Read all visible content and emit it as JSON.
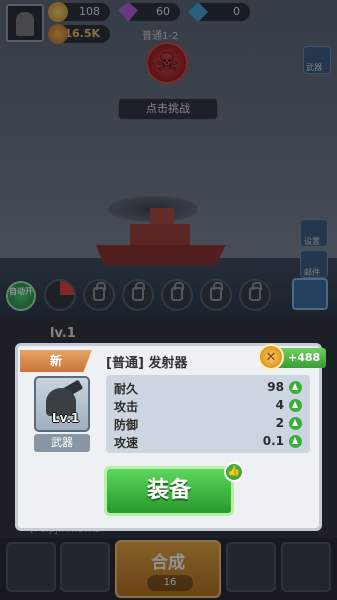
{
  "topbar": {
    "gold": "108",
    "gems": "60",
    "crystals": "0",
    "power": "16.5K",
    "stage": "普通1-2"
  },
  "boss": {
    "challenge_label": "点击挑战"
  },
  "side": {
    "weapon_label": "武器",
    "mail_label": "邮件",
    "settings_label": "设置"
  },
  "skills": {
    "auto_label": "自动开"
  },
  "panel": {
    "level": "lv.1",
    "merge_label": "合成",
    "merge_cost": "16",
    "chat_line": "[Pulpjmm0wis"
  },
  "modal": {
    "new_tag": "新",
    "item_title": "[普通] 发射器",
    "reward": "+488",
    "item_level": "Lv.1",
    "item_type": "武器",
    "stats": [
      {
        "name": "耐久",
        "value": "98"
      },
      {
        "name": "攻击",
        "value": "4"
      },
      {
        "name": "防御",
        "value": "2"
      },
      {
        "name": "攻速",
        "value": "0.1"
      }
    ],
    "equip_label": "装备"
  }
}
